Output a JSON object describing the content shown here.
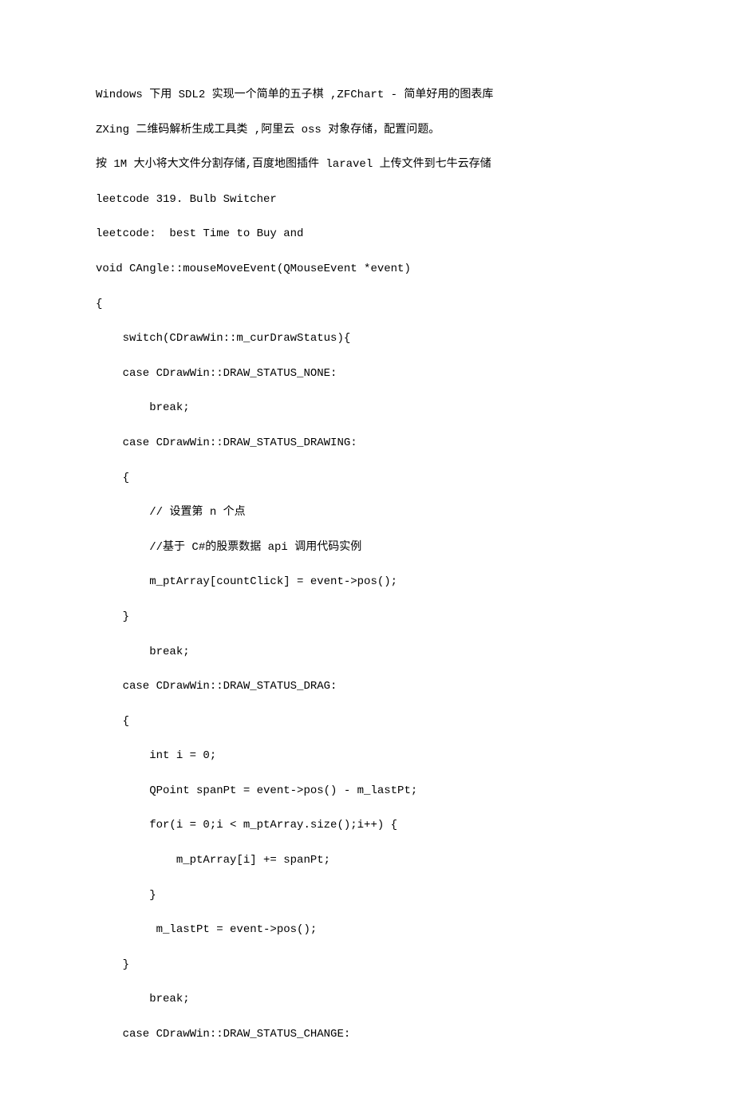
{
  "lines": [
    "Windows 下用 SDL2 实现一个简单的五子棋 ,ZFChart - 简单好用的图表库",
    "ZXing 二维码解析生成工具类 ,阿里云 oss 对象存储，配置问题。",
    "按 1M 大小将大文件分割存储,百度地图插件 laravel 上传文件到七牛云存储",
    "leetcode 319. Bulb Switcher",
    "leetcode:  best Time to Buy and",
    "void CAngle::mouseMoveEvent(QMouseEvent *event)",
    "{",
    "    switch(CDrawWin::m_curDrawStatus){",
    "    case CDrawWin::DRAW_STATUS_NONE:",
    "        break;",
    "    case CDrawWin::DRAW_STATUS_DRAWING:",
    "    {",
    "        // 设置第 n 个点",
    "        //基于 C#的股票数据 api 调用代码实例",
    "        m_ptArray[countClick] = event->pos();",
    "    }",
    "        break;",
    "    case CDrawWin::DRAW_STATUS_DRAG:",
    "    {",
    "        int i = 0;",
    "        QPoint spanPt = event->pos() - m_lastPt;",
    "        for(i = 0;i < m_ptArray.size();i++) {",
    "            m_ptArray[i] += spanPt;",
    "        }",
    "         m_lastPt = event->pos();",
    "    }",
    "        break;",
    "    case CDrawWin::DRAW_STATUS_CHANGE:"
  ]
}
